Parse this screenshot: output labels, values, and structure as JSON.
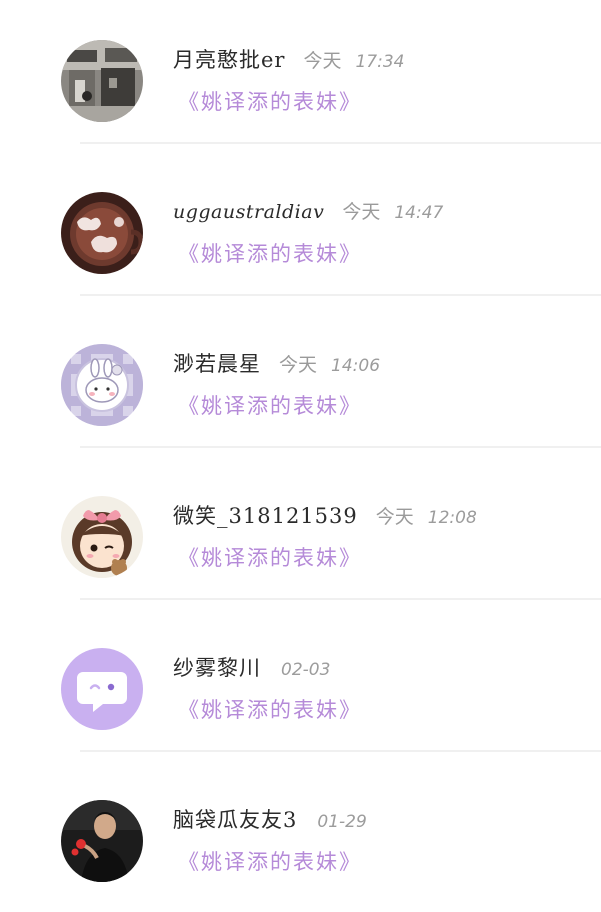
{
  "mention_list": [
    {
      "username": "月亮憨批er",
      "date": "今天",
      "time": "17:34",
      "mention": "《姚译添的表妹》",
      "avatar": "street-photo-avatar"
    },
    {
      "username": "uggaustraldiav",
      "date": "今天",
      "time": "14:47",
      "mention": "《姚译添的表妹》",
      "avatar": "hot-cocoa-avatar"
    },
    {
      "username": "渺若晨星",
      "date": "今天",
      "time": "14:06",
      "mention": "《姚译添的表妹》",
      "avatar": "bunny-plaid-avatar"
    },
    {
      "username": "微笑_318121539",
      "date": "今天",
      "time": "12:08",
      "mention": "《姚译添的表妹》",
      "avatar": "cartoon-girl-avatar"
    },
    {
      "username": "纱雾黎川",
      "date": "02-03",
      "time": "",
      "mention": "《姚译添的表妹》",
      "avatar": "default-chat-bubble-avatar"
    },
    {
      "username": "脑袋瓜友友3",
      "date": "01-29",
      "time": "",
      "mention": "《姚译添的表妹》",
      "avatar": "person-photo-avatar"
    }
  ],
  "colors": {
    "username": "#2b2b2b",
    "timestamp": "#9a9a9a",
    "mention": "#b58ad8",
    "divider": "#f0f0f0",
    "default_avatar_bg": "#c9b0f0"
  }
}
